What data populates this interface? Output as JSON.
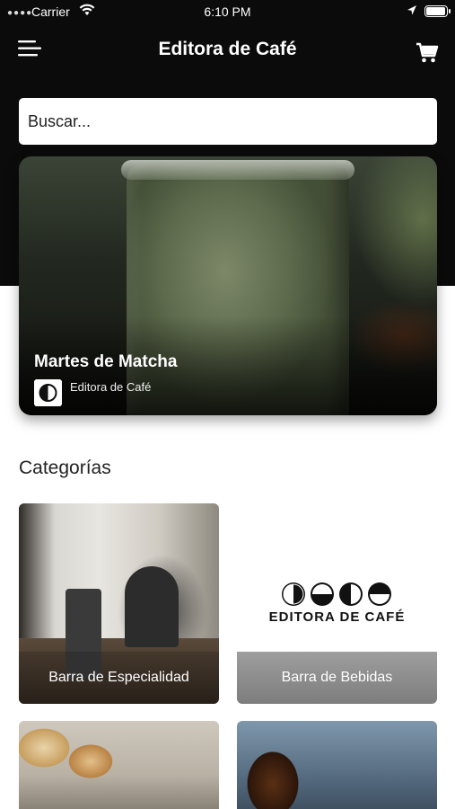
{
  "status_bar": {
    "carrier": "Carrier",
    "time": "6:10 PM",
    "battery_level": 1.0
  },
  "nav": {
    "title": "Editora de Café",
    "menu_icon": "hamburger-menu-icon",
    "cart_icon": "shopping-cart-icon"
  },
  "search": {
    "placeholder": "Buscar..."
  },
  "featured": {
    "title": "Martes de Matcha",
    "author": "Editora de Café"
  },
  "categories": {
    "heading": "Categorías",
    "items": [
      {
        "label": "Barra de Especialidad"
      },
      {
        "label": "Barra de Bebidas",
        "brand_text": "EDITORA DE CAFÉ"
      },
      {
        "label": ""
      },
      {
        "label": ""
      }
    ]
  },
  "colors": {
    "header_background": "#0b0b0b",
    "page_background": "#ffffff",
    "accent_gray": "#8a8a8a"
  }
}
